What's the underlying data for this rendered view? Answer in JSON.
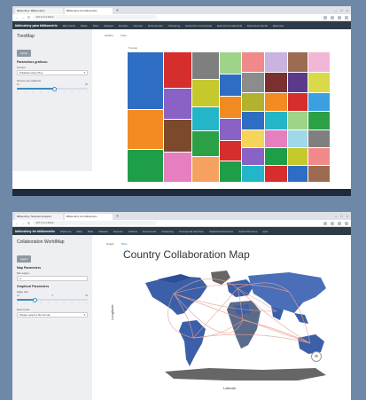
{
  "colors": {
    "page_bg": "#6e88a8",
    "navbar": "#2c3b47",
    "sidebar": "#edeff2",
    "accent": "#3c8dbc"
  },
  "shot1": {
    "tabs": [
      "Biblioshiny: Bibliometrix",
      "Biblioshiny for bibliometrix"
    ],
    "url": "127.0.0.1:4413",
    "brand": "biblioshiny para bibliometrix",
    "nav": [
      "Más Venta",
      "Datos",
      "Filtro",
      "Dataset",
      "Fuentes",
      "Autores",
      "Documentos",
      "Clustering",
      "Estructura Conceptual",
      "Estructura Intelectual",
      "Estructura Social",
      "Reportes"
    ],
    "sidebar": {
      "title": "TreeMap",
      "button": "Iniciar",
      "head": "Parámetros gráficos:",
      "field_label": "Campo:",
      "field_value": "Palabras clave Plus",
      "slider_label": "Número de palabras",
      "slider_min": "10",
      "slider_max": "50"
    },
    "tabs_main": [
      "Gráfico",
      "Tabla"
    ],
    "treemap_header": "Treemap"
  },
  "shot2": {
    "tabs": [
      "Biblioshiny: Network Analysis",
      "Biblioshiny for bibliometrix"
    ],
    "url": "127.0.0.1:4413",
    "brand": "biblioshiny for bibliometrix",
    "nav": [
      "Welcome",
      "Data",
      "Filter",
      "Dataset",
      "Sources",
      "Authors",
      "Documents",
      "Clustering",
      "Conceptual Structure",
      "Intellectual Structure",
      "Social Structure",
      "Quit"
    ],
    "sidebar": {
      "title": "Collaboration WorldMap",
      "button": "Apply!",
      "head1": "Map Parameters",
      "edges_label": "Min edges",
      "edges_value": "2",
      "head2": "Graphical Parameters",
      "edgesize_label": "Edge size",
      "slider_min": "0.1",
      "slider_val": "5",
      "slider_max": "20",
      "export_label": "Export plot",
      "export_value": "Please select a file format"
    },
    "tabs_main": [
      "Graph",
      "Table"
    ],
    "map_title": "Country Collaboration Map",
    "y_label": "Longitude",
    "x_label": "Latitude"
  },
  "icons": [
    "back-icon",
    "forward-icon",
    "reload-icon",
    "zoom-icon"
  ]
}
